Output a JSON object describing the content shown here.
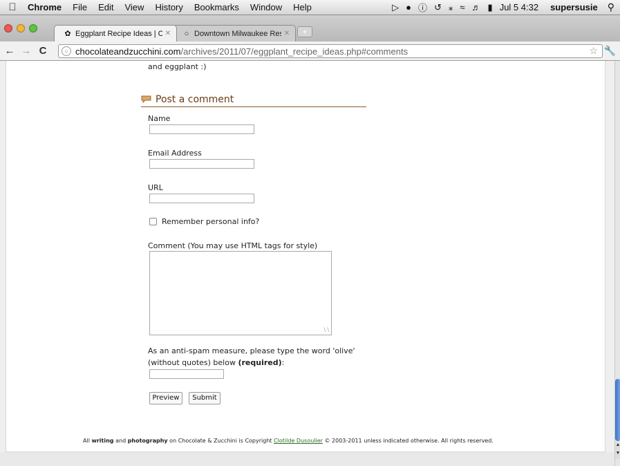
{
  "menubar": {
    "app": "Chrome",
    "items": [
      "File",
      "Edit",
      "View",
      "History",
      "Bookmarks",
      "Window",
      "Help"
    ],
    "date_time": "Jul 5  4:32",
    "user": "supersusie"
  },
  "tabs": [
    {
      "title": "Eggplant Recipe Ideas | Cho",
      "active": true
    },
    {
      "title": "Downtown Milwaukee Restau",
      "active": false
    }
  ],
  "address": {
    "host": "chocolateandzucchini.com",
    "path": "/archives/2011/07/eggplant_recipe_ideas.php#comments"
  },
  "page": {
    "previous_text": "and eggplant :)",
    "section_title": "Post a comment",
    "name_label": "Name",
    "email_label": "Email Address",
    "url_label": "URL",
    "remember_label": "Remember personal info?",
    "comment_label": "Comment (You may use HTML tags for style)",
    "antispam_line1": "As an anti-spam measure, please type the word 'olive'",
    "antispam_line2": "(without quotes) below",
    "antispam_required": "(required)",
    "antispam_colon": ":",
    "preview_button": "Preview",
    "submit_button": "Submit"
  },
  "footer": {
    "p1": "All ",
    "writing": "writing",
    "p2": " and ",
    "photography": "photography",
    "p3": " on Chocolate & Zucchini is Copyright ",
    "author": "Clotilde Dusoulier",
    "p4": " © 2003-2011 unless indicated otherwise. All rights reserved."
  },
  "colors": {
    "heading": "#6b3b14",
    "heading_rule": "#8a5a2b",
    "footer_link": "#2a6b22",
    "scroll_thumb": "#3b73c9"
  }
}
